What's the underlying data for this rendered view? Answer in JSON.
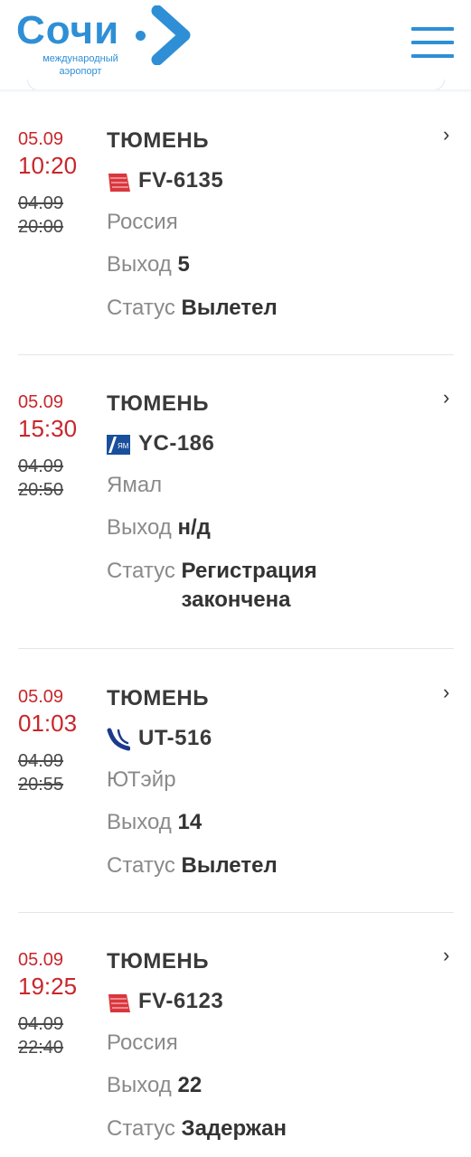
{
  "header": {
    "logo_word": "Сочи",
    "logo_subtitle": "международный аэропорт",
    "menu_icon": "hamburger-menu-icon",
    "brand_color": "#2e8fd6"
  },
  "flights": [
    {
      "date": "05.09",
      "time": "10:20",
      "old_datetime": "04.09\n20:00",
      "city": "ТЮМЕНЬ",
      "flight_number": "FV-6135",
      "airline": "Россия",
      "gate_label": "Выход",
      "gate": "5",
      "status_label": "Статус",
      "status": "Вылетел",
      "airline_icon": "rossiya-logo-icon"
    },
    {
      "date": "05.09",
      "time": "15:30",
      "old_datetime": "04.09\n20:50",
      "city": "ТЮМЕНЬ",
      "flight_number": "YC-186",
      "airline": "Ямал",
      "gate_label": "Выход",
      "gate": "н/д",
      "status_label": "Статус",
      "status": "Регистрация закончена",
      "airline_icon": "yamal-logo-icon"
    },
    {
      "date": "05.09",
      "time": "01:03",
      "old_datetime": "04.09\n20:55",
      "city": "ТЮМЕНЬ",
      "flight_number": "UT-516",
      "airline": "ЮТэйр",
      "gate_label": "Выход",
      "gate": "14",
      "status_label": "Статус",
      "status": "Вылетел",
      "airline_icon": "utair-logo-icon"
    },
    {
      "date": "05.09",
      "time": "19:25",
      "old_datetime": "04.09\n22:40",
      "city": "ТЮМЕНЬ",
      "flight_number": "FV-6123",
      "airline": "Россия",
      "gate_label": "Выход",
      "gate": "22",
      "status_label": "Статус",
      "status": "Задержан",
      "airline_icon": "rossiya-logo-icon"
    }
  ],
  "colors": {
    "time_red": "#c8262b",
    "label_gray": "#8a8a8a",
    "text_dark": "#333333"
  }
}
